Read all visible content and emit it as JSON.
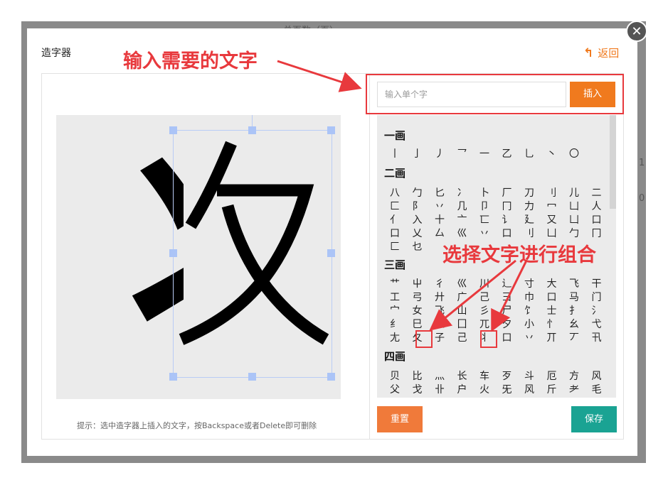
{
  "background_page": {
    "header_text": "总页数（页）",
    "side_values": [
      "1",
      "0"
    ]
  },
  "dialog": {
    "title": "造字器",
    "back_label": "返回",
    "close_symbol": "✕",
    "canvas_char_left": "丬",
    "hint": "提示：选中造字器上插入的文字，按Backspace或者Delete即可删除",
    "input_placeholder": "输入单个字",
    "insert_label": "插入",
    "reset_label": "重置",
    "save_label": "保存",
    "sections": [
      {
        "title": "一画",
        "rows": [
          [
            "丨",
            "亅",
            "丿",
            "乛",
            "一",
            "乙",
            "乚",
            "丶",
            "〇"
          ]
        ]
      },
      {
        "title": "二画",
        "rows": [
          [
            "八",
            "勹",
            "匕",
            "冫",
            "卜",
            "厂",
            "刀",
            "刂",
            "儿",
            "二"
          ],
          [
            "匚",
            "阝",
            "丷",
            "几",
            "卩",
            "冂",
            "力",
            "冖",
            "凵",
            "人"
          ],
          [
            "亻",
            "入",
            "十",
            "亠",
            "匸",
            "讠",
            "廴",
            "又",
            "凵",
            "口"
          ],
          [
            "口",
            "乂",
            "厶",
            "巛",
            "丷",
            "口",
            "刂",
            "凵",
            "勹",
            "冂"
          ],
          [
            "匚",
            "乜",
            "",
            "",
            "",
            "",
            "",
            "",
            "",
            ""
          ]
        ]
      },
      {
        "title": "三画",
        "rows": [
          [
            "艹",
            "屮",
            "彳",
            "巛",
            "川",
            "辶",
            "寸",
            "大",
            "飞",
            "干"
          ],
          [
            "工",
            "弓",
            "廾",
            "广",
            "己",
            "彐",
            "巾",
            "口",
            "马",
            "门"
          ],
          [
            "宀",
            "女",
            "飞",
            "山",
            "彡",
            "尸",
            "饣",
            "士",
            "扌",
            "氵"
          ],
          [
            "纟",
            "巳",
            "土",
            "囗",
            "兀",
            "夕",
            "小",
            "忄",
            "幺",
            "弋"
          ],
          [
            "尢",
            "夂",
            "子",
            "己",
            "丬",
            "口",
            "丷",
            "丌",
            "丆",
            "卂"
          ]
        ]
      },
      {
        "title": "四画",
        "rows": [
          [
            "贝",
            "比",
            "灬",
            "长",
            "车",
            "歹",
            "斗",
            "厄",
            "方",
            "风"
          ],
          [
            "父",
            "戈",
            "卝",
            "户",
            "火",
            "旡",
            "风",
            "斤",
            "耂",
            "毛"
          ]
        ]
      }
    ]
  },
  "annotations": {
    "input_note": "输入需要的文字",
    "combine_note": "选择文字进行组合"
  },
  "colors": {
    "accent_orange": "#f07a1e",
    "save_teal": "#1aa393",
    "annotation_red": "#e8393d"
  }
}
